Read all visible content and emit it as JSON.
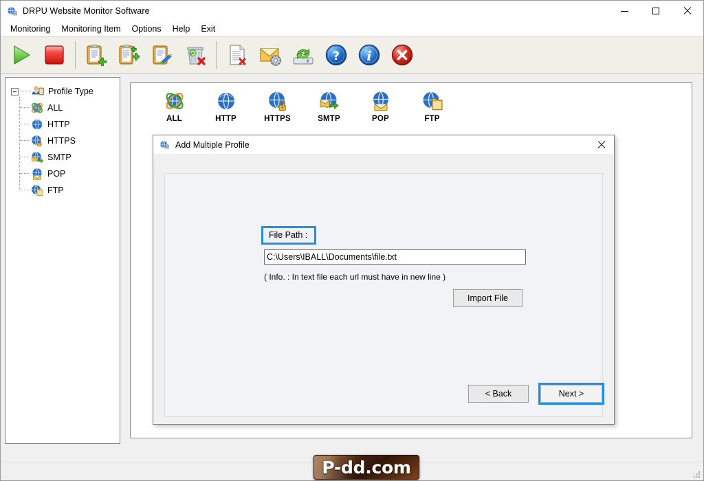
{
  "window": {
    "title": "DRPU Website Monitor Software",
    "icon": "app-globe-icon",
    "minimize_label": "Minimize",
    "maximize_label": "Maximize",
    "close_label": "Close"
  },
  "menu": {
    "items": [
      {
        "label": "Monitoring",
        "name": "menu-monitoring"
      },
      {
        "label": "Monitoring Item",
        "name": "menu-monitoring-item"
      },
      {
        "label": "Options",
        "name": "menu-options"
      },
      {
        "label": "Help",
        "name": "menu-help"
      },
      {
        "label": "Exit",
        "name": "menu-exit"
      }
    ]
  },
  "toolbar": {
    "buttons": [
      {
        "name": "start-monitoring-button",
        "icon": "play-icon",
        "tooltip": "Start"
      },
      {
        "name": "stop-monitoring-button",
        "icon": "stop-icon",
        "tooltip": "Stop"
      },
      {
        "name": "add-profile-button",
        "icon": "clipboard-add-icon",
        "tooltip": "Add Profile"
      },
      {
        "name": "add-multiple-profile-button",
        "icon": "clipboard-add-multiple-icon",
        "tooltip": "Add Multiple Profile"
      },
      {
        "name": "edit-profile-button",
        "icon": "clipboard-edit-icon",
        "tooltip": "Edit Profile"
      },
      {
        "name": "delete-profile-button",
        "icon": "trash-delete-icon",
        "tooltip": "Delete Profile"
      },
      {
        "name": "clear-log-button",
        "icon": "document-delete-icon",
        "tooltip": "Clear Log"
      },
      {
        "name": "email-settings-button",
        "icon": "mail-gear-icon",
        "tooltip": "Email Settings"
      },
      {
        "name": "backup-restore-button",
        "icon": "drive-refresh-icon",
        "tooltip": "Backup / Restore"
      },
      {
        "name": "help-button",
        "icon": "help-question-icon",
        "tooltip": "Help"
      },
      {
        "name": "about-button",
        "icon": "info-icon",
        "tooltip": "About"
      },
      {
        "name": "exit-button",
        "icon": "close-circle-icon",
        "tooltip": "Exit"
      }
    ]
  },
  "sidebar": {
    "root": {
      "label": "Profile Type",
      "icon": "user-profile-icon",
      "expanded": true
    },
    "items": [
      {
        "label": "ALL",
        "icon": "globe-orbit-icon"
      },
      {
        "label": "HTTP",
        "icon": "globe-icon"
      },
      {
        "label": "HTTPS",
        "icon": "globe-lock-icon"
      },
      {
        "label": "SMTP",
        "icon": "globe-mail-send-icon"
      },
      {
        "label": "POP",
        "icon": "globe-envelope-icon"
      },
      {
        "label": "FTP",
        "icon": "globe-folder-icon"
      }
    ]
  },
  "profile_tabs": [
    {
      "label": "ALL",
      "icon": "globe-orbit-icon",
      "name": "tab-all"
    },
    {
      "label": "HTTP",
      "icon": "globe-icon",
      "name": "tab-http"
    },
    {
      "label": "HTTPS",
      "icon": "globe-lock-icon",
      "name": "tab-https"
    },
    {
      "label": "SMTP",
      "icon": "globe-mail-send-icon",
      "name": "tab-smtp"
    },
    {
      "label": "POP",
      "icon": "globe-envelope-icon",
      "name": "tab-pop"
    },
    {
      "label": "FTP",
      "icon": "globe-folder-icon",
      "name": "tab-ftp"
    }
  ],
  "dialog": {
    "title": "Add Multiple Profile",
    "icon": "app-globe-icon",
    "close_label": "Close",
    "file_path_label": "File Path :",
    "file_path_value": "C:\\Users\\IBALL\\Documents\\file.txt",
    "file_path_placeholder": "",
    "info_text": "( Info. : In text file each url must have in new line )",
    "import_button": "Import File",
    "back_button": "< Back",
    "next_button": "Next >"
  },
  "watermark": {
    "text": "P-dd.com"
  },
  "colors": {
    "focus_blue": "#1e90e8",
    "accent_red": "#d52b1e",
    "accent_green": "#4caf2f",
    "window_chrome": "#f0f0f0",
    "toolbar_bg": "#f0efe8",
    "dialog_inner_bg": "#f1f3f7"
  }
}
